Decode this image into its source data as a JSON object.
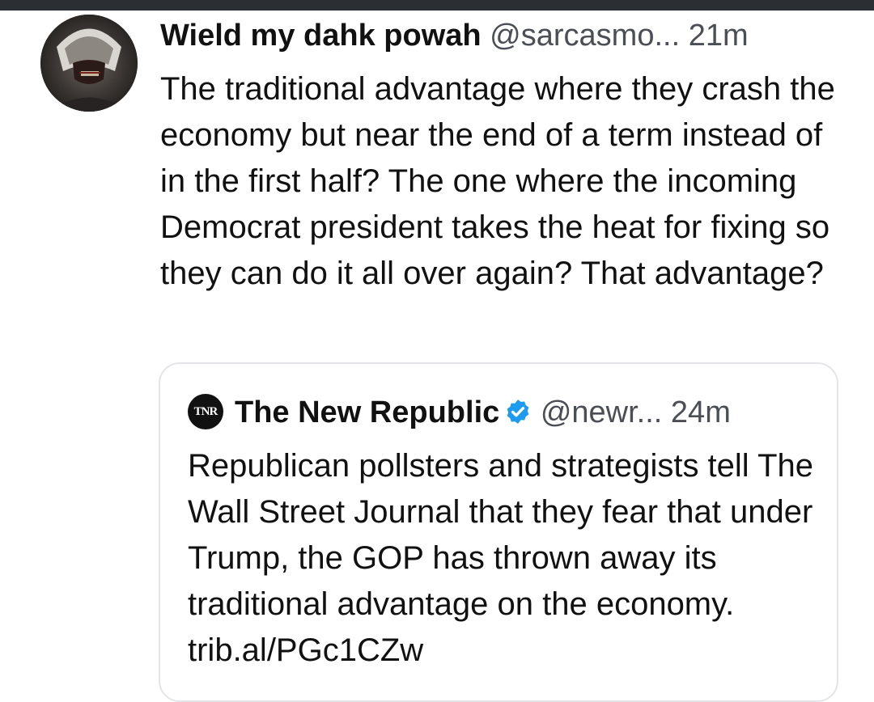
{
  "post": {
    "display_name": "Wield my dahk powah",
    "handle": "@sarcasmo...",
    "time": "21m",
    "avatar_icon": "dark-figure-avatar",
    "text": "The traditional advantage where they crash the economy but near the end of a term instead of in the first half? The one where the incoming Democrat president takes the heat for fixing so they can do it all over again? That advantage?"
  },
  "quote": {
    "logo_text": "TNR",
    "display_name": "The New Republic",
    "verified_icon": "verified-check-icon",
    "verified_color": "#1d9bf0",
    "handle": "@newr...",
    "time": "24m",
    "text": "Republican pollsters and strategists tell The Wall Street Journal that they fear that under Trump, the GOP has thrown away its traditional advantage on the economy. trib.al/PGc1CZw"
  }
}
